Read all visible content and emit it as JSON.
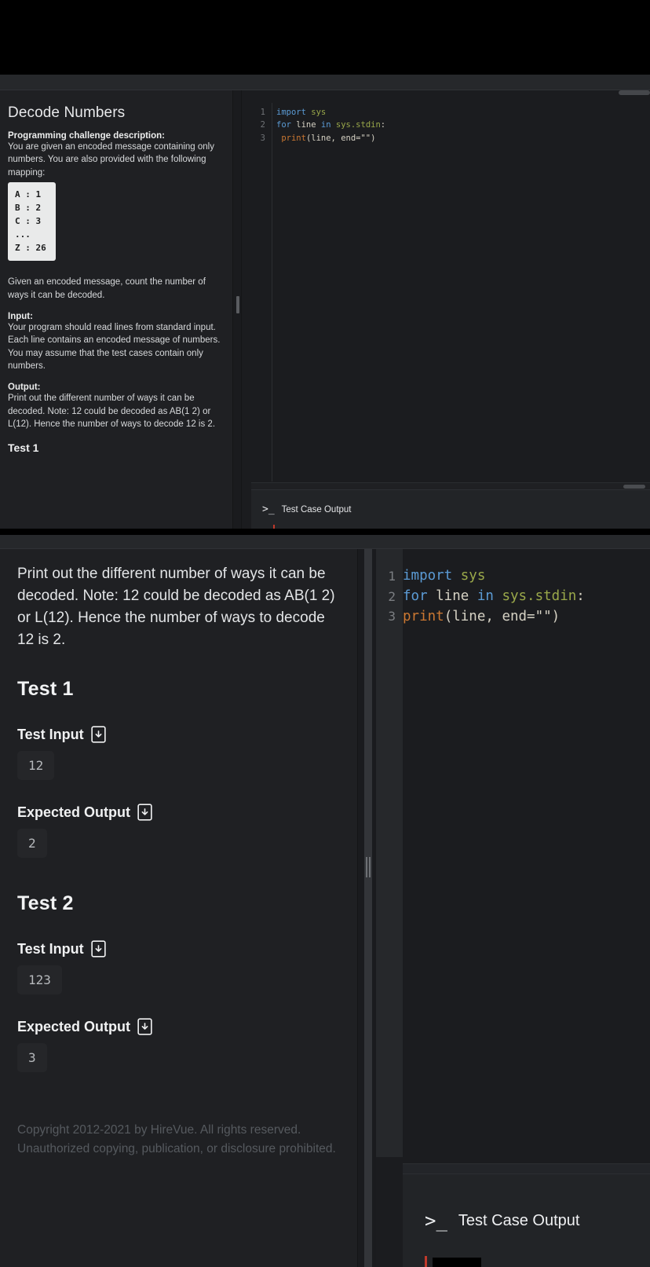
{
  "problem": {
    "title": "Decode Numbers",
    "desc_heading": "Programming challenge description:",
    "desc_body": "You are given an encoded message containing only numbers. You are also provided with the following mapping:",
    "mapping_block": "A : 1\nB : 2\nC : 3\n...\nZ : 26",
    "given_para": "Given an encoded message, count the number of ways it can be decoded.",
    "input_heading": "Input:",
    "input_body": "Your program should read lines from standard input. Each line contains an encoded message of numbers. You may assume that the test cases contain only numbers.",
    "output_heading": "Output:",
    "output_body": "Print out the different number of ways it can be decoded. Note: 12 could be decoded as AB(1 2) or L(12). Hence the number of ways to decode 12 is 2."
  },
  "tests": [
    {
      "heading": "Test 1",
      "input_label": "Test Input",
      "input_value": "12",
      "expected_label": "Expected Output",
      "expected_value": "2"
    },
    {
      "heading": "Test 2",
      "input_label": "Test Input",
      "input_value": "123",
      "expected_label": "Expected Output",
      "expected_value": "3"
    }
  ],
  "footer": {
    "copyright": "Copyright 2012-2021 by HireVue. All rights reserved. Unauthorized copying, publication, or disclosure prohibited."
  },
  "editor": {
    "lines": [
      "1",
      "2",
      "3"
    ],
    "code": {
      "l1_kw": "import",
      "l1_mod": " sys",
      "l2_kw1": "for",
      "l2_id": " line ",
      "l2_kw2": "in",
      "l2_mod": " sys.stdin",
      "l2_colon": ":",
      "l3_indent": "    ",
      "l3_fn": "print",
      "l3_args": "(line, end=\"\")"
    }
  },
  "output_panel": {
    "prompt": ">_",
    "label": "Test Case Output"
  }
}
